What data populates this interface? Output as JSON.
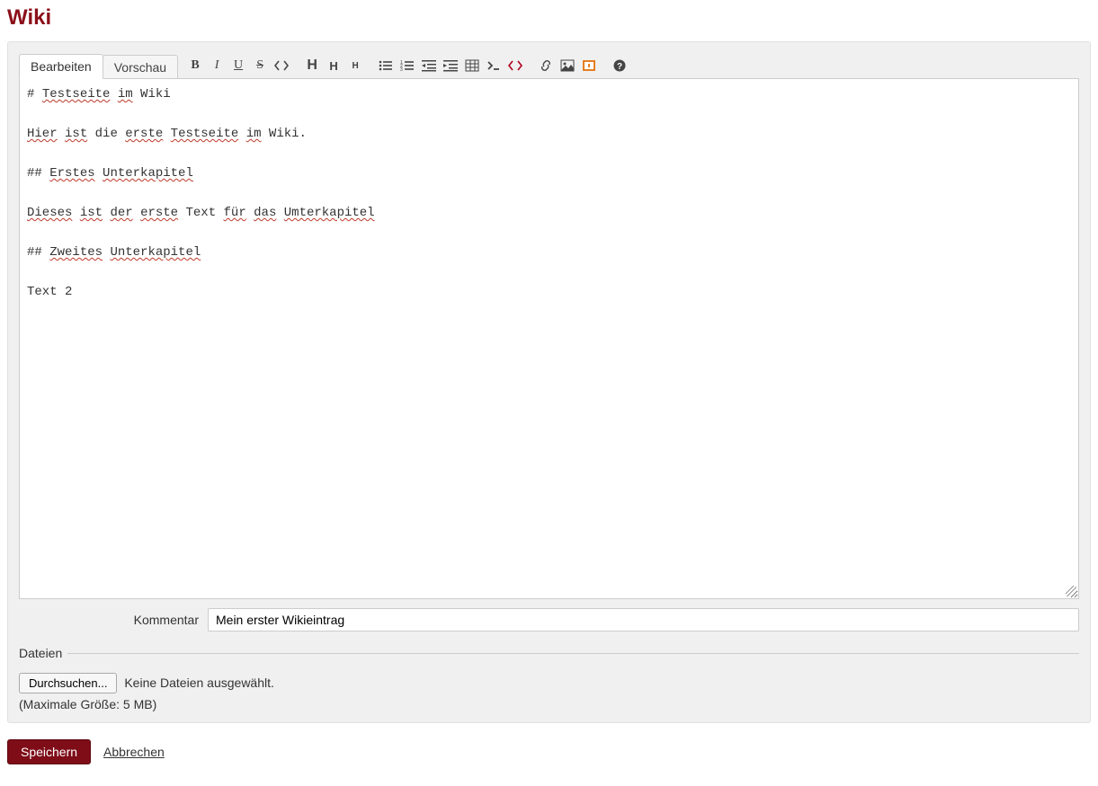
{
  "page": {
    "title": "Wiki"
  },
  "tabs": {
    "edit": "Bearbeiten",
    "preview": "Vorschau"
  },
  "editor": {
    "tokens": [
      {
        "t": "# "
      },
      {
        "t": "Testseite",
        "s": true
      },
      {
        "t": " "
      },
      {
        "t": "im",
        "s": true
      },
      {
        "t": " Wiki\n\n"
      },
      {
        "t": "Hier",
        "s": true
      },
      {
        "t": " "
      },
      {
        "t": "ist",
        "s": true
      },
      {
        "t": " die "
      },
      {
        "t": "erste",
        "s": true
      },
      {
        "t": " "
      },
      {
        "t": "Testseite",
        "s": true
      },
      {
        "t": " "
      },
      {
        "t": "im",
        "s": true
      },
      {
        "t": " Wiki.\n\n"
      },
      {
        "t": "## "
      },
      {
        "t": "Erstes",
        "s": true
      },
      {
        "t": " "
      },
      {
        "t": "Unterkapitel",
        "s": true
      },
      {
        "t": "\n\n"
      },
      {
        "t": "Dieses",
        "s": true
      },
      {
        "t": " "
      },
      {
        "t": "ist",
        "s": true
      },
      {
        "t": " "
      },
      {
        "t": "der",
        "s": true
      },
      {
        "t": " "
      },
      {
        "t": "erste",
        "s": true
      },
      {
        "t": " Text "
      },
      {
        "t": "für",
        "s": true
      },
      {
        "t": " "
      },
      {
        "t": "das",
        "s": true
      },
      {
        "t": " "
      },
      {
        "t": "Umterkapitel",
        "s": true
      },
      {
        "t": "\n\n"
      },
      {
        "t": "## "
      },
      {
        "t": "Zweites",
        "s": true
      },
      {
        "t": " "
      },
      {
        "t": "Unterkapitel",
        "s": true
      },
      {
        "t": "\n\n"
      },
      {
        "t": "Text 2"
      }
    ]
  },
  "comment": {
    "label": "Kommentar",
    "value": "Mein erster Wikieintrag"
  },
  "files": {
    "legend": "Dateien",
    "browse": "Durchsuchen...",
    "status": "Keine Dateien ausgewählt.",
    "hint": "(Maximale Größe: 5 MB)"
  },
  "actions": {
    "save": "Speichern",
    "cancel": "Abbrechen"
  },
  "toolbar": {
    "bold": "B",
    "italic": "I",
    "underline": "U",
    "strike": "S",
    "h1": "H",
    "h2": "H",
    "h3": "H"
  }
}
